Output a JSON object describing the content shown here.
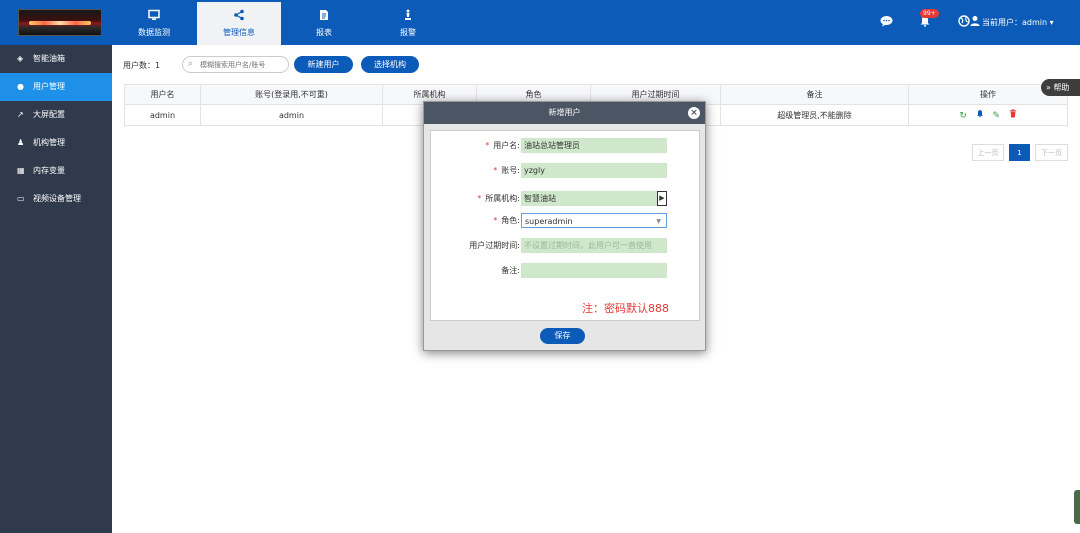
{
  "nav": {
    "tabs": [
      {
        "label": "数据监测",
        "icon": "monitor-icon"
      },
      {
        "label": "管理信息",
        "icon": "share-icon"
      },
      {
        "label": "报表",
        "icon": "document-icon"
      },
      {
        "label": "报警",
        "icon": "alarm-icon"
      }
    ],
    "badge": "99+",
    "user_label": "当前用户：admin ▾"
  },
  "sidebar": {
    "items": [
      {
        "label": "智能油箱",
        "icon": "box-icon"
      },
      {
        "label": "用户管理",
        "icon": "user-icon"
      },
      {
        "label": "大屏配置",
        "icon": "chart-icon"
      },
      {
        "label": "机构管理",
        "icon": "org-icon"
      },
      {
        "label": "内存变量",
        "icon": "memory-icon"
      },
      {
        "label": "视频设备管理",
        "icon": "monitor-icon"
      }
    ]
  },
  "toolbar": {
    "count_label": "用户数：1",
    "search_placeholder": "模糊搜索用户名/账号",
    "new_user_label": "新建用户",
    "select_org_label": "选择机构"
  },
  "table": {
    "headers": [
      "用户名",
      "账号(登录用,不可重)",
      "所属机构",
      "角色",
      "用户过期时间",
      "备注",
      "操作"
    ],
    "rows": [
      {
        "username": "admin",
        "account": "admin",
        "org": "智",
        "role": "",
        "expire": "",
        "remark": "超级管理员,不能删除"
      }
    ]
  },
  "pager": {
    "prev": "上一页",
    "current": "1",
    "next": "下一页"
  },
  "help_label": "帮助",
  "dialog": {
    "title": "新增用户",
    "fields": {
      "username_label": "用户名:",
      "username_value": "油站总站管理员",
      "account_label": "账号:",
      "account_value": "yzgly",
      "org_label": "所属机构:",
      "org_value": "智慧油站",
      "role_label": "角色:",
      "role_value": "superadmin",
      "expire_label": "用户过期时间:",
      "expire_placeholder": "不设置过期时间，此用户可一直使用",
      "remark_label": "备注:",
      "remark_value": ""
    },
    "note": "注：密码默认888",
    "save_label": "保存"
  },
  "colors": {
    "primary": "#0c5bb8",
    "sidebar": "#2f3b4c",
    "sidebar_active": "#1e90e8",
    "field_bg": "#cfe8cc",
    "danger": "#e53935"
  }
}
